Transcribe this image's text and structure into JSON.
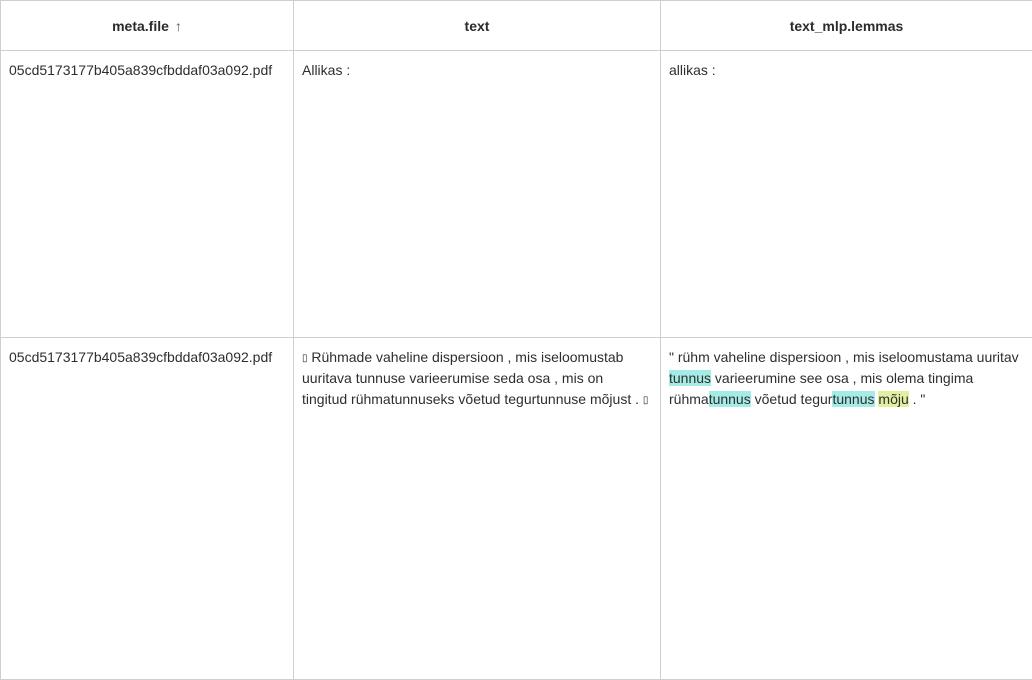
{
  "columns": [
    {
      "label": "meta.file",
      "sort_icon": "arrow-up-icon",
      "sort_glyph": "↑"
    },
    {
      "label": "text"
    },
    {
      "label": "text_mlp.lemmas"
    }
  ],
  "rows": [
    {
      "file": "05cd5173177b405a839cfbddaf03a092.pdf",
      "text": "Allikas :",
      "lemmas": "allikas :"
    },
    {
      "file": "05cd5173177b405a839cfbddaf03a092.pdf",
      "text_box1": "▯",
      "text_body": " Rühmade vaheline dispersioon , mis iseloomustab uuritava tunnuse varieerumise seda osa , mis on tingitud rühmatunnuseks võetud tegurtunnuse mõjust . ",
      "text_box2": "▯",
      "lemmas_parts": {
        "p1": "\" rühm vaheline dispersioon , mis iseloomustama uuritav ",
        "h1": "tunnus",
        "p2": " varieerumine see osa , mis olema tingima rühma",
        "h2": "tunnus",
        "p3": " võetud tegur",
        "h3": "tunnus",
        "p4": " ",
        "h4": "mõju",
        "p5": " . \""
      }
    }
  ],
  "colors": {
    "highlight_cyan": "#a5ece6",
    "highlight_lime": "#e3efa0",
    "border": "#cfcfcf"
  }
}
